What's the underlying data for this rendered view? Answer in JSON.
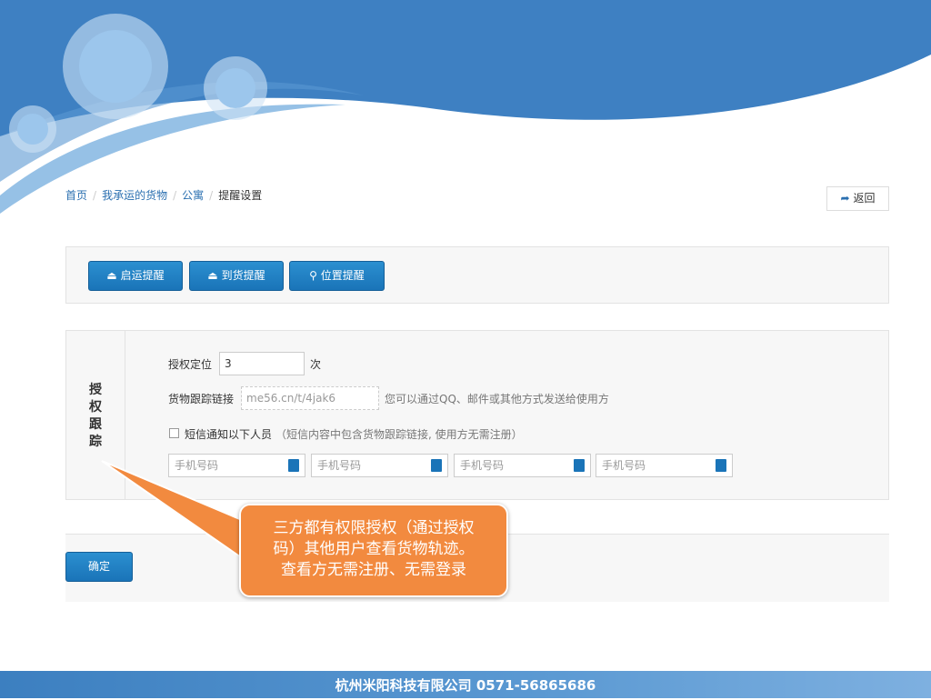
{
  "breadcrumb": [
    "首页",
    "我承运的货物",
    "公寓",
    "提醒设置"
  ],
  "back_label": "返回",
  "buttons": [
    "启运提醒",
    "到货提醒",
    "位置提醒"
  ],
  "section_title": [
    "授",
    "权",
    "跟",
    "踪"
  ],
  "auth_label": "授权定位",
  "auth_value": "3",
  "auth_unit": "次",
  "link_label": "货物跟踪链接",
  "link_value": "me56.cn/t/4jak6",
  "link_hint": "您可以通过QQ、邮件或其他方式发送给使用方",
  "sms_label": "短信通知以下人员",
  "sms_hint": "（短信内容中包含货物跟踪链接, 使用方无需注册）",
  "phone_placeholder": "手机号码",
  "confirm_label": "确定",
  "callout": [
    "三方都有权限授权（通过授权",
    "码）其他用户查看货物轨迹。",
    "查看方无需注册、无需登录"
  ],
  "footer": "杭州米阳科技有限公司   0571-56865686"
}
